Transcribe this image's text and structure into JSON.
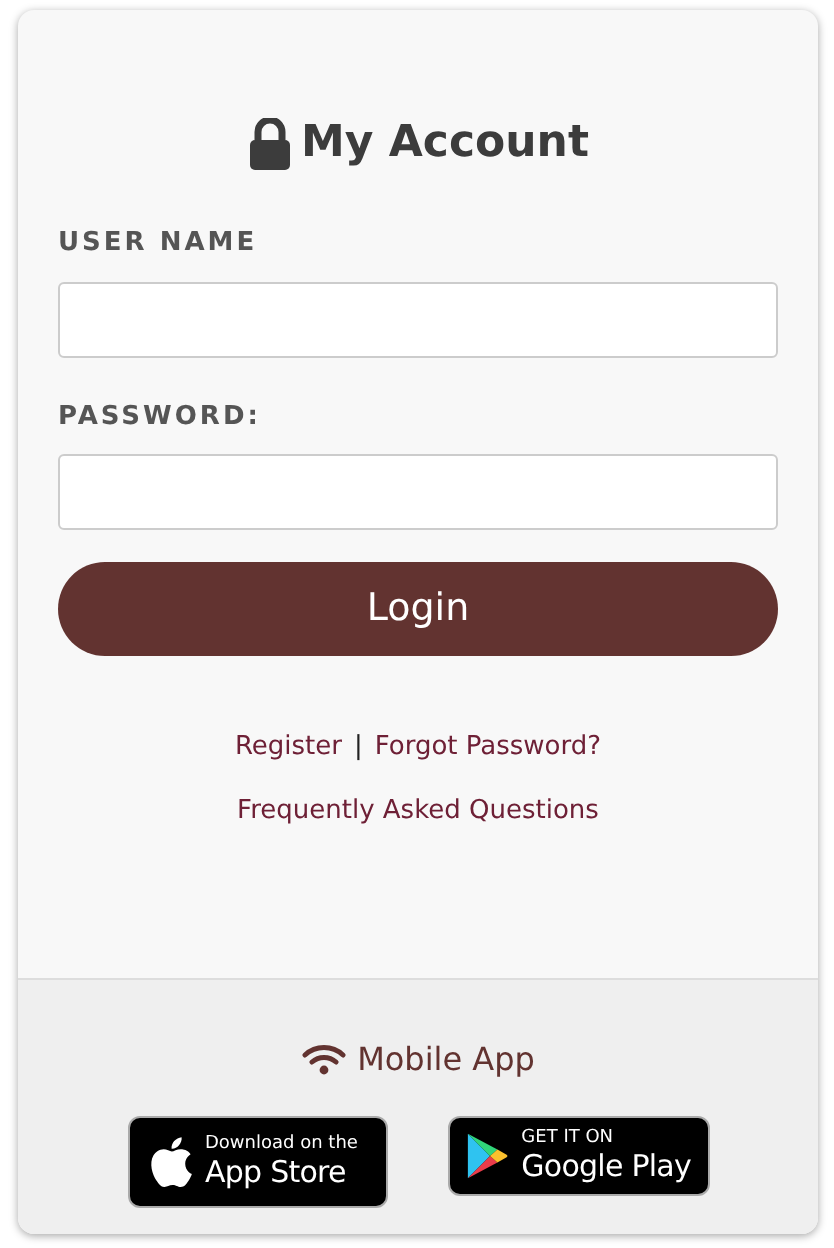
{
  "title": "My Account",
  "fields": [
    {
      "label": "USER NAME"
    },
    {
      "label": "PASSWORD:"
    }
  ],
  "login_button": "Login",
  "links": {
    "register": "Register",
    "separator": "|",
    "forgot": "Forgot Password?",
    "faq": "Frequently Asked Questions"
  },
  "mobile": {
    "title": "Mobile App",
    "badges": [
      {
        "kind": "apple",
        "small": "Download on the",
        "big": "App Store"
      },
      {
        "kind": "google",
        "small": "GET IT ON",
        "big": "Google Play"
      }
    ]
  }
}
